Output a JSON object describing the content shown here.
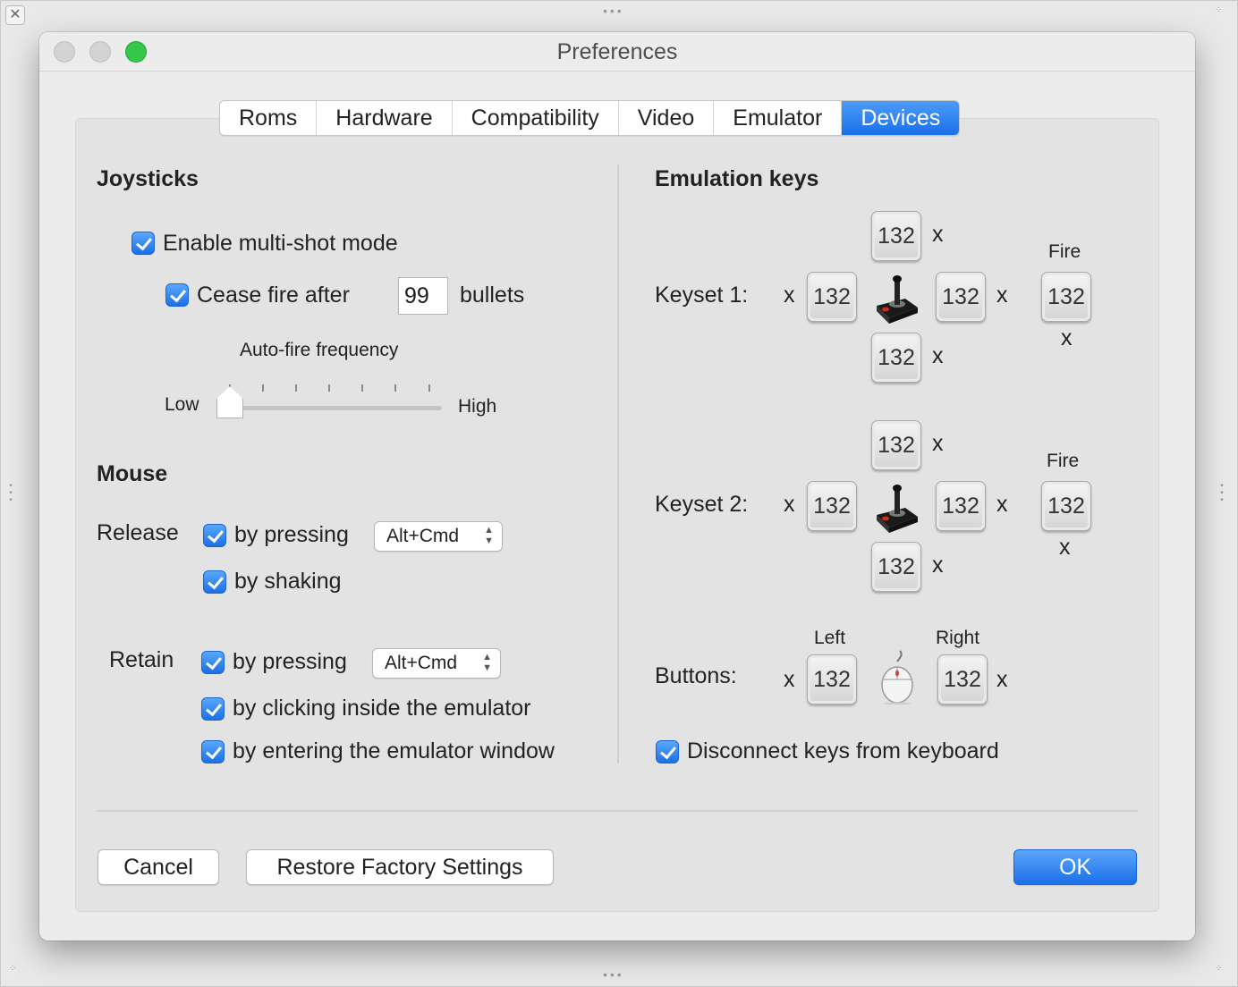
{
  "window": {
    "title": "Preferences"
  },
  "tabs": [
    "Roms",
    "Hardware",
    "Compatibility",
    "Video",
    "Emulator",
    "Devices"
  ],
  "active_tab": "Devices",
  "joysticks": {
    "heading": "Joysticks",
    "multishot_label": "Enable multi-shot mode",
    "multishot_checked": true,
    "cease_fire_label": "Cease fire after",
    "cease_fire_checked": true,
    "bullets_value": "99",
    "bullets_label": "bullets",
    "autofire_label": "Auto-fire frequency",
    "low_label": "Low",
    "high_label": "High",
    "autofire_level": 0
  },
  "mouse": {
    "heading": "Mouse",
    "release_label": "Release",
    "release_pressing_label": "by pressing",
    "release_combo": "Alt+Cmd",
    "release_shaking_label": "by shaking",
    "retain_label": "Retain",
    "retain_pressing_label": "by pressing",
    "retain_combo": "Alt+Cmd",
    "retain_clicking_label": "by clicking inside the emulator",
    "retain_entering_label": "by entering the emulator window"
  },
  "emulation_keys": {
    "heading": "Emulation keys",
    "keyset1": {
      "label": "Keyset 1:",
      "fire_label": "Fire",
      "up": "132",
      "left": "132",
      "right": "132",
      "down": "132",
      "fire": "132",
      "up_x": "x",
      "left_x": "x",
      "right_x": "x",
      "down_x": "x",
      "fire_x": "x"
    },
    "keyset2": {
      "label": "Keyset 2:",
      "fire_label": "Fire",
      "up": "132",
      "left": "132",
      "right": "132",
      "down": "132",
      "fire": "132",
      "up_x": "x",
      "left_x": "x",
      "right_x": "x",
      "down_x": "x",
      "fire_x": "x"
    },
    "buttons": {
      "label": "Buttons:",
      "left_label": "Left",
      "right_label": "Right",
      "left": "132",
      "right": "132",
      "left_x": "x",
      "right_x": "x"
    },
    "disconnect_label": "Disconnect keys from keyboard"
  },
  "footer": {
    "cancel": "Cancel",
    "restore": "Restore Factory Settings",
    "ok": "OK"
  },
  "colors": {
    "accent": "#1c6fe8",
    "traffic_green": "#34c748"
  }
}
